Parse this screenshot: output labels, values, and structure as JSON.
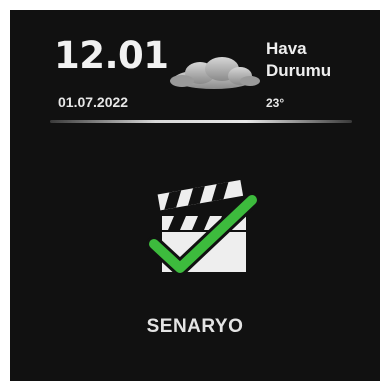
{
  "header": {
    "time": "12.01",
    "date": "01.07.2022",
    "weather": {
      "label_line1": "Hava",
      "label_line2": "Durumu",
      "temperature": "23°",
      "icon": "cloud-icon"
    }
  },
  "main": {
    "app": {
      "label": "SENARYO",
      "icon": "clapperboard-check-icon",
      "check_color": "#3dbb3d"
    }
  },
  "colors": {
    "background": "#111111",
    "text": "#eeeeee"
  }
}
